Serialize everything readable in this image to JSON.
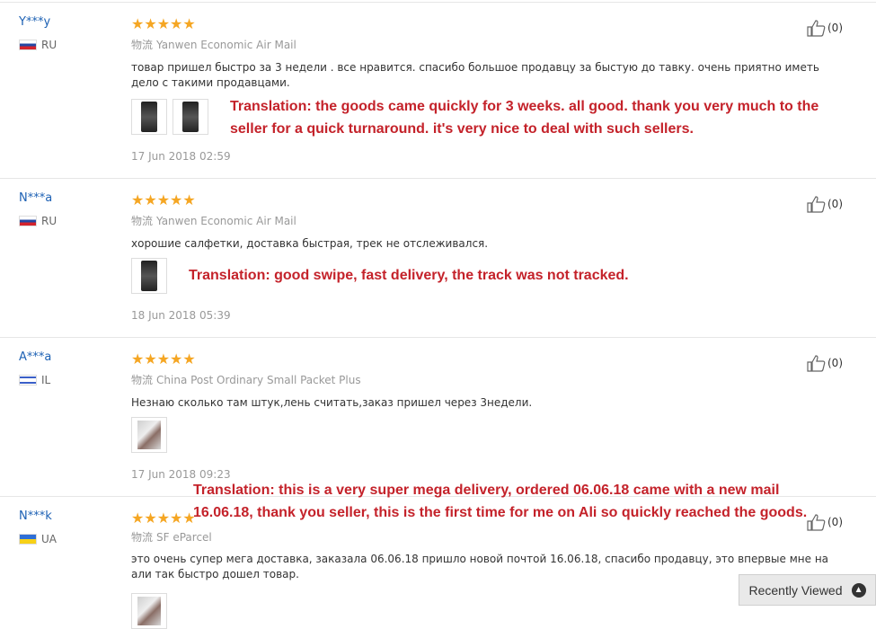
{
  "reviews": [
    {
      "user": "Y***y",
      "country": "RU",
      "stars": "★★★★★",
      "shipping_label": "物流",
      "shipping": "Yanwen Economic Air Mail",
      "text": "товар пришел быстро за 3 недели . все нравится. спасибо большое продавцу за быстую до тавку. очень приятно иметь дело с такими продавцами.",
      "date": "17 Jun 2018 02:59",
      "likes": "(0)"
    },
    {
      "user": "N***a",
      "country": "RU",
      "stars": "★★★★★",
      "shipping_label": "物流",
      "shipping": "Yanwen Economic Air Mail",
      "text": "хорошие салфетки, доставка быстрая, трек не отслеживался.",
      "date": "18 Jun 2018 05:39",
      "likes": "(0)"
    },
    {
      "user": "A***a",
      "country": "IL",
      "stars": "★★★★★",
      "shipping_label": "物流",
      "shipping": "China Post Ordinary Small Packet Plus",
      "text": "Незнаю сколько там штук,лень считать,заказ пришел через 3недели.",
      "date": "17 Jun 2018 09:23",
      "likes": "(0)"
    },
    {
      "user": "N***k",
      "country": "UA",
      "stars": "★★★★★",
      "shipping_label": "物流",
      "shipping": "SF eParcel",
      "text": "это очень супер мега доставка, заказала 06.06.18 пришло новой почтой 16.06.18, спасибо продавцу, это впервые мне на али так быстро дошел товар.",
      "likes": "(0)"
    }
  ],
  "translations": {
    "t1": "Translation: the goods came quickly for 3 weeks. all good. thank you very much to the seller for a quick turnaround. it's very nice to deal with such sellers.",
    "t2": "Translation: good swipe, fast delivery, the track was not tracked.",
    "t3": "Translation: this is a very super mega delivery, ordered 06.06.18 came with a new mail 16.06.18, thank you seller, this is the first time for me on Ali so quickly reached the goods."
  },
  "recently_viewed": "Recently Viewed",
  "colors": {
    "username": "#1d61b4",
    "stars": "#f5a623",
    "translation": "#c4222a"
  },
  "icons": {
    "like": "thumbs-up-icon",
    "chevron": "chevron-up-icon"
  }
}
